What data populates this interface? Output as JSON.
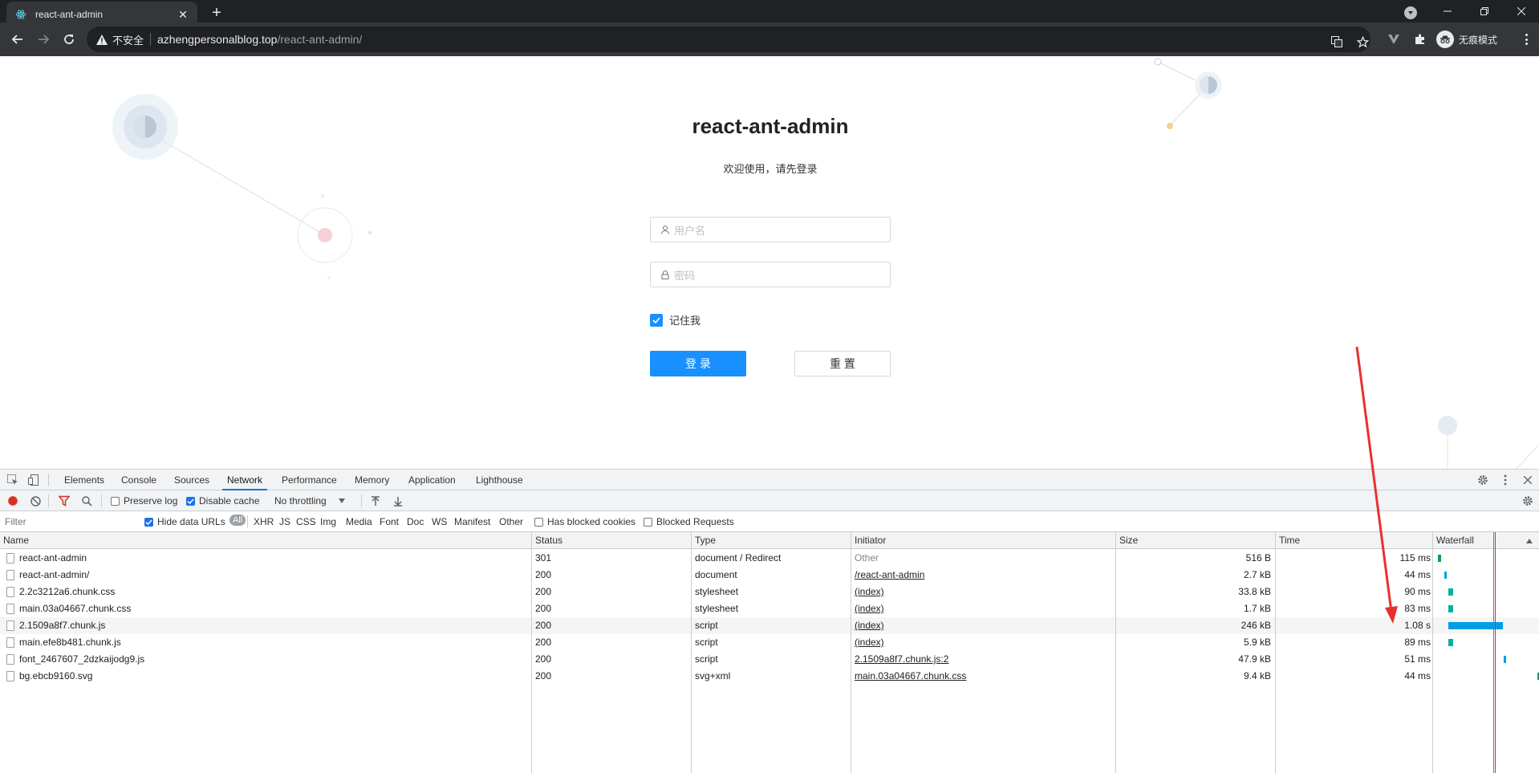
{
  "browser": {
    "tab_title": "react-ant-admin",
    "new_tab": "+",
    "address": {
      "security_label": "不安全",
      "host": "azhengpersonalblog.top",
      "path": "/react-ant-admin/"
    },
    "profile_label": "无痕模式"
  },
  "page": {
    "title": "react-ant-admin",
    "subtitle": "欢迎使用，请先登录",
    "username_placeholder": "用户名",
    "password_placeholder": "密码",
    "remember_label": "记住我",
    "remember_checked": true,
    "login_button": "登 录",
    "reset_button": "重 置",
    "colors": {
      "primary": "#1890ff"
    }
  },
  "devtools": {
    "tabs": [
      "Elements",
      "Console",
      "Sources",
      "Network",
      "Performance",
      "Memory",
      "Application",
      "Lighthouse"
    ],
    "active_tab": "Network",
    "controls": {
      "preserve_log": "Preserve log",
      "preserve_log_checked": false,
      "disable_cache": "Disable cache",
      "disable_cache_checked": true,
      "throttling": "No throttling"
    },
    "filter": {
      "placeholder": "Filter",
      "hide_data_urls": "Hide data URLs",
      "hide_data_urls_checked": true,
      "types": [
        "All",
        "XHR",
        "JS",
        "CSS",
        "Img",
        "Media",
        "Font",
        "Doc",
        "WS",
        "Manifest",
        "Other"
      ],
      "has_blocked_cookies": "Has blocked cookies",
      "blocked_requests": "Blocked Requests"
    },
    "columns": [
      "Name",
      "Status",
      "Type",
      "Initiator",
      "Size",
      "Time",
      "Waterfall"
    ],
    "rows": [
      {
        "name": "react-ant-admin",
        "status": "301",
        "type": "document / Redirect",
        "initiator": "Other",
        "initiator_link": false,
        "size": "516 B",
        "time": "115 ms",
        "wf_start": 0.02,
        "wf_len": 0.03,
        "wf_color": "#0f9d58"
      },
      {
        "name": "react-ant-admin/",
        "status": "200",
        "type": "document",
        "initiator": "/react-ant-admin",
        "initiator_link": true,
        "size": "2.7 kB",
        "time": "44 ms",
        "wf_start": 0.08,
        "wf_len": 0.02,
        "wf_color": "#009fe3"
      },
      {
        "name": "2.2c3212a6.chunk.css",
        "status": "200",
        "type": "stylesheet",
        "initiator": "(index)",
        "initiator_link": true,
        "size": "33.8 kB",
        "time": "90 ms",
        "wf_start": 0.12,
        "wf_len": 0.05,
        "wf_color": "#00b0a0"
      },
      {
        "name": "main.03a04667.chunk.css",
        "status": "200",
        "type": "stylesheet",
        "initiator": "(index)",
        "initiator_link": true,
        "size": "1.7 kB",
        "time": "83 ms",
        "wf_start": 0.12,
        "wf_len": 0.05,
        "wf_color": "#00b0a0"
      },
      {
        "name": "2.1509a8f7.chunk.js",
        "status": "200",
        "type": "script",
        "initiator": "(index)",
        "initiator_link": true,
        "size": "246 kB",
        "time": "1.08 s",
        "wf_start": 0.12,
        "wf_len": 0.55,
        "wf_color": "#009fe3"
      },
      {
        "name": "main.efe8b481.chunk.js",
        "status": "200",
        "type": "script",
        "initiator": "(index)",
        "initiator_link": true,
        "size": "5.9 kB",
        "time": "89 ms",
        "wf_start": 0.12,
        "wf_len": 0.05,
        "wf_color": "#00b0a0"
      },
      {
        "name": "font_2467607_2dzkaijodg9.js",
        "status": "200",
        "type": "script",
        "initiator": "2.1509a8f7.chunk.js:2",
        "initiator_link": true,
        "size": "47.9 kB",
        "time": "51 ms",
        "wf_start": 0.68,
        "wf_len": 0.02,
        "wf_color": "#009fe3"
      },
      {
        "name": "bg.ebcb9160.svg",
        "status": "200",
        "type": "svg+xml",
        "initiator": "main.03a04667.chunk.css",
        "initiator_link": true,
        "size": "9.4 kB",
        "time": "44 ms",
        "wf_start": 1.02,
        "wf_len": 0.02,
        "wf_color": "#0f9d58"
      }
    ]
  }
}
